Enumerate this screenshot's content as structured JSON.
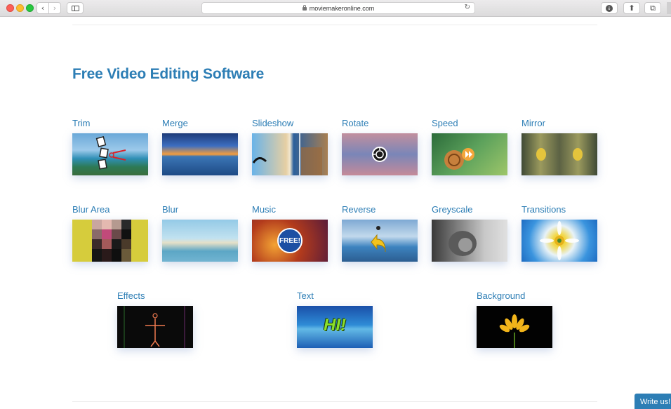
{
  "browser": {
    "url": "moviemakeronline.com",
    "back_glyph": "‹",
    "forward_glyph": "›",
    "reload_glyph": "↻",
    "download_glyph": "↓",
    "share_glyph": "⬆",
    "tabs_glyph": "⧉"
  },
  "page": {
    "title": "Free Video Editing Software",
    "write_us": "Write us!"
  },
  "tools_row1": [
    {
      "label": "Trim",
      "icon": "trim-thumbnail"
    },
    {
      "label": "Merge",
      "icon": "merge-thumbnail"
    },
    {
      "label": "Slideshow",
      "icon": "slideshow-thumbnail"
    },
    {
      "label": "Rotate",
      "icon": "rotate-thumbnail"
    },
    {
      "label": "Speed",
      "icon": "speed-thumbnail"
    },
    {
      "label": "Mirror",
      "icon": "mirror-thumbnail"
    }
  ],
  "tools_row2": [
    {
      "label": "Blur Area",
      "icon": "blur-area-thumbnail"
    },
    {
      "label": "Blur",
      "icon": "blur-thumbnail"
    },
    {
      "label": "Music",
      "icon": "music-thumbnail",
      "badge": "FREE!"
    },
    {
      "label": "Reverse",
      "icon": "reverse-thumbnail"
    },
    {
      "label": "Greyscale",
      "icon": "greyscale-thumbnail"
    },
    {
      "label": "Transitions",
      "icon": "transitions-thumbnail"
    }
  ],
  "tools_row3": [
    {
      "label": "Effects",
      "icon": "effects-thumbnail"
    },
    {
      "label": "Text",
      "icon": "text-thumbnail",
      "badge": "HI!"
    },
    {
      "label": "Background",
      "icon": "background-thumbnail"
    }
  ],
  "colors": {
    "link": "#2d7eb5",
    "accent_button": "#2d7eb5"
  }
}
